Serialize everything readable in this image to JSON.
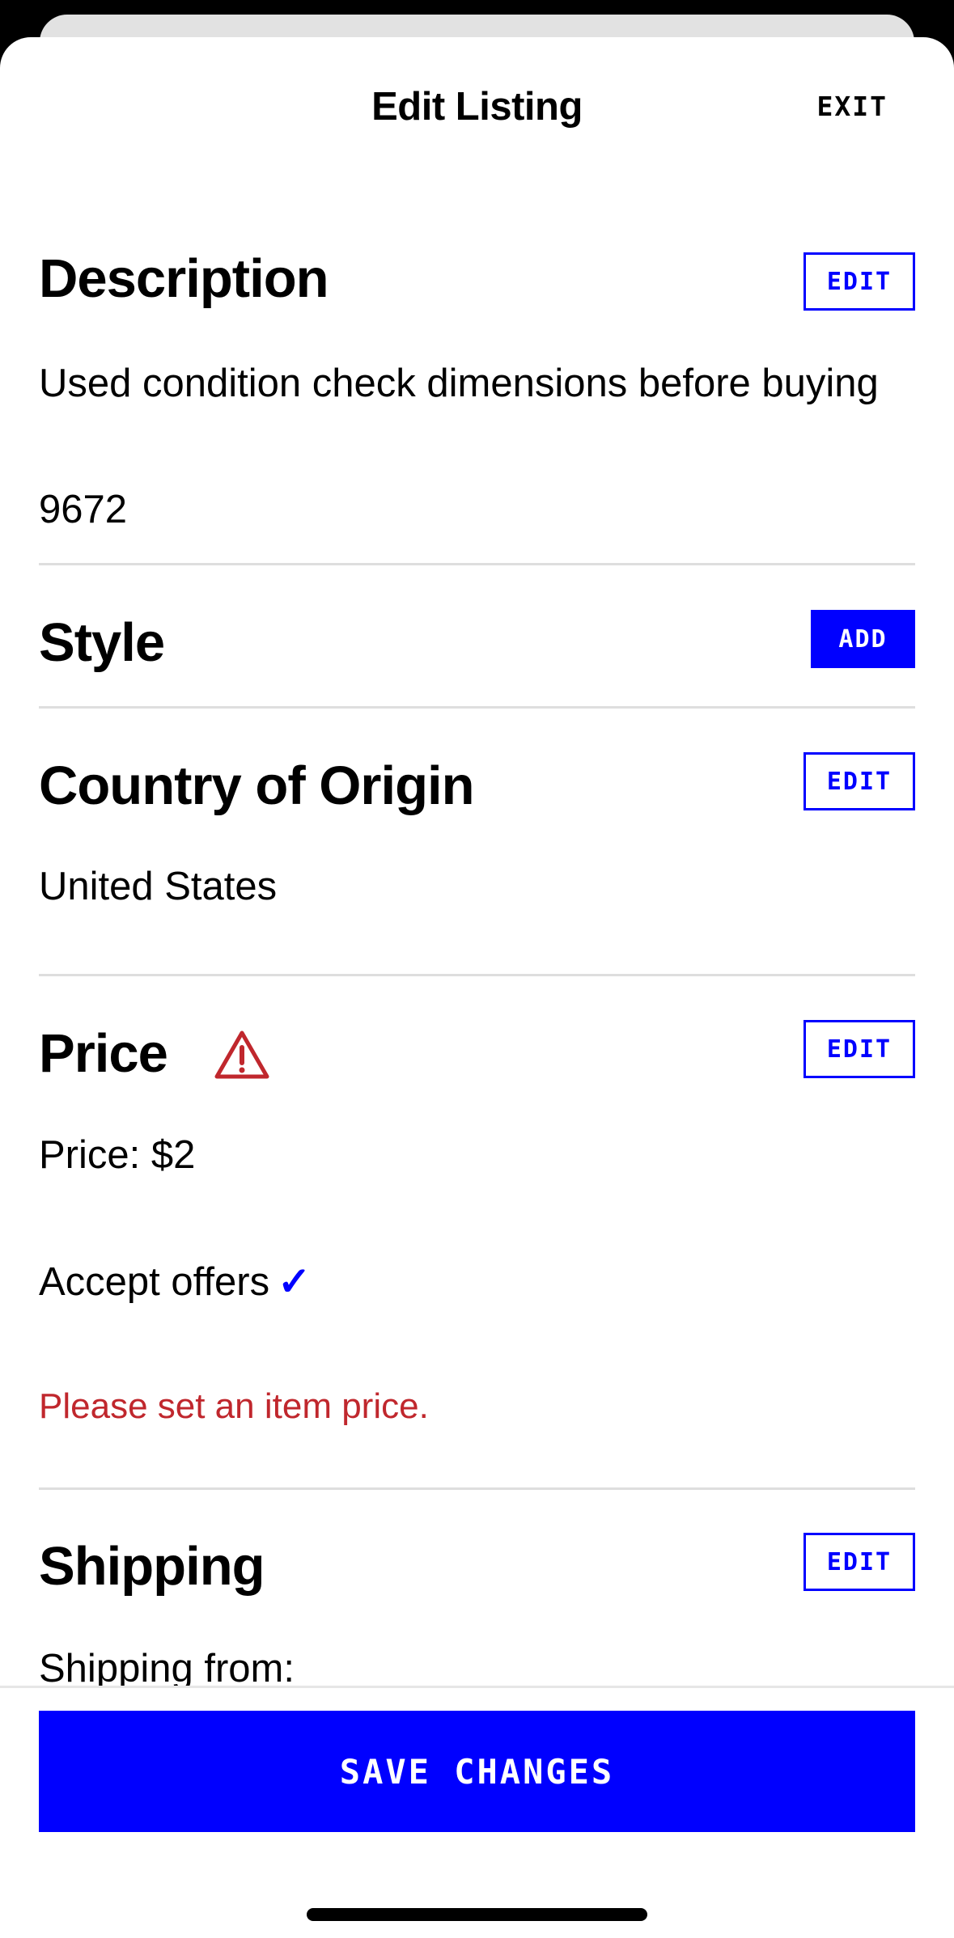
{
  "header": {
    "title": "Edit Listing",
    "exit_label": "EXIT"
  },
  "description": {
    "title": "Description",
    "button_label": "EDIT",
    "text": "Used condition check dimensions before buying",
    "code": "9672"
  },
  "style": {
    "title": "Style",
    "button_label": "ADD"
  },
  "country": {
    "title": "Country of Origin",
    "button_label": "EDIT",
    "value": "United States"
  },
  "price": {
    "title": "Price",
    "button_label": "EDIT",
    "price_line": "Price: $2",
    "offers_line": "Accept offers",
    "offers_checked": true,
    "check_glyph": "✓",
    "error": "Please set an item price.",
    "warning_icon": "warning-triangle-icon",
    "error_color": "#c0272d"
  },
  "shipping": {
    "title": "Shipping",
    "button_label": "EDIT",
    "from_label": "Shipping from:"
  },
  "footer": {
    "save_label": "SAVE CHANGES"
  },
  "colors": {
    "accent": "#0000ff",
    "error": "#c0272d",
    "divider": "#dedede"
  }
}
